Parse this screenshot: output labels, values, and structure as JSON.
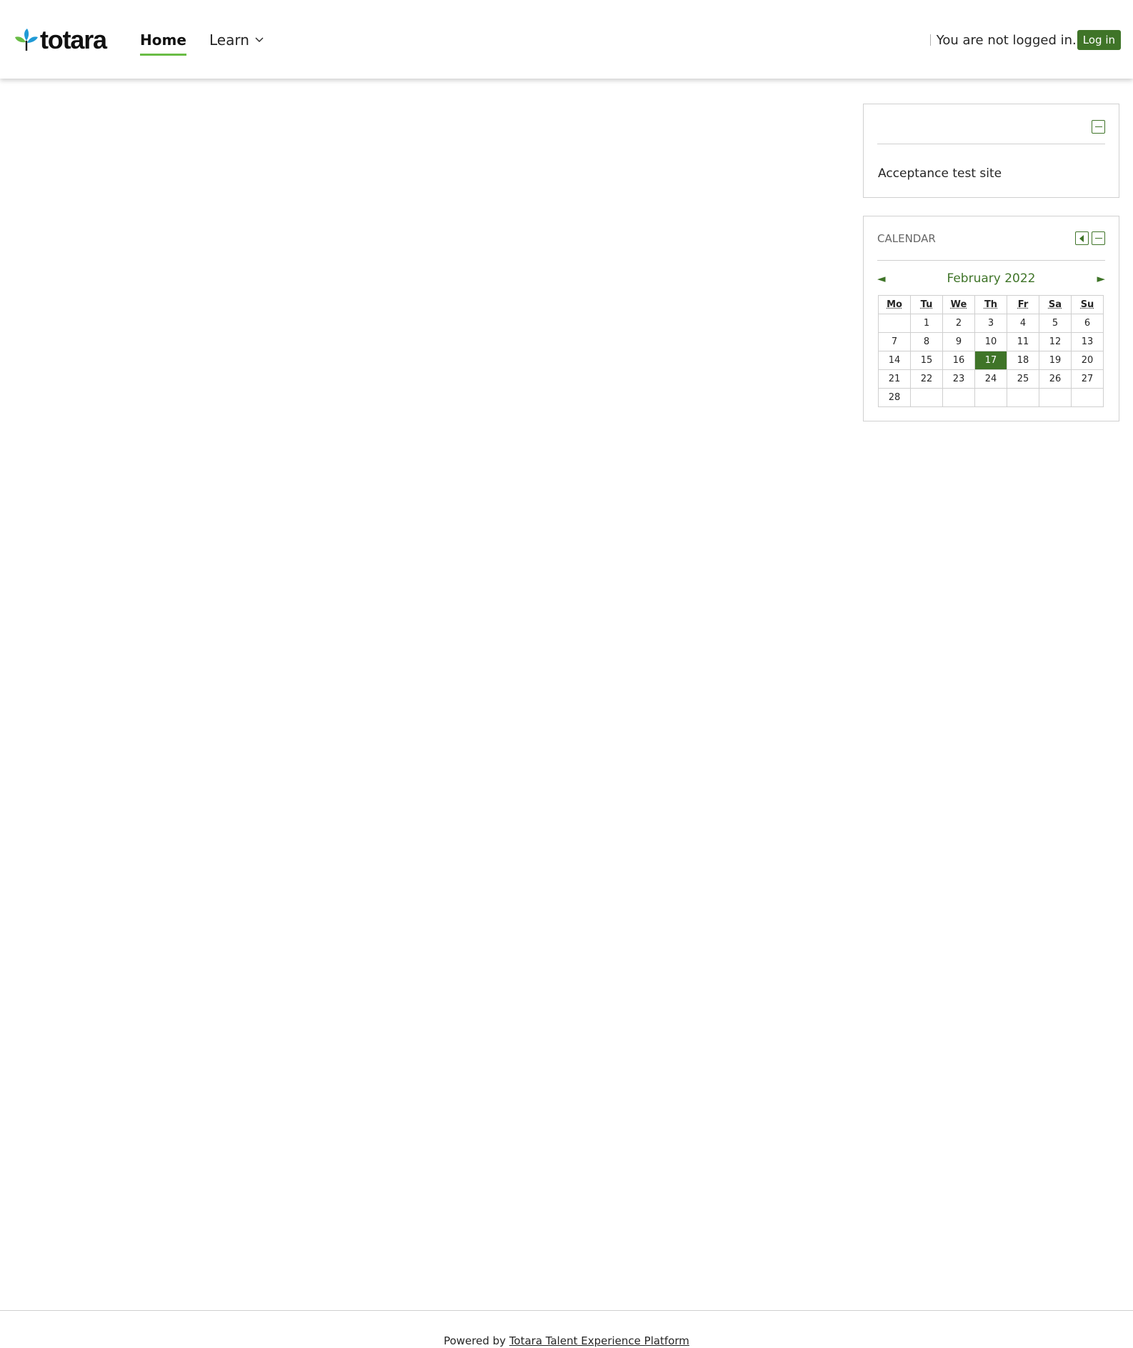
{
  "header": {
    "logo_text": "totara",
    "nav": {
      "home_label": "Home",
      "learn_label": "Learn"
    },
    "login_status": "You are not logged in.",
    "login_button": "Log in"
  },
  "site_block": {
    "text": "Acceptance test site"
  },
  "calendar_block": {
    "title": "CALENDAR",
    "month_label": "February 2022",
    "prev_arrow": "◄",
    "next_arrow": "►",
    "weekdays": [
      "Mo",
      "Tu",
      "We",
      "Th",
      "Fr",
      "Sa",
      "Su"
    ],
    "weeks": [
      [
        "",
        "1",
        "2",
        "3",
        "4",
        "5",
        "6"
      ],
      [
        "7",
        "8",
        "9",
        "10",
        "11",
        "12",
        "13"
      ],
      [
        "14",
        "15",
        "16",
        "17",
        "18",
        "19",
        "20"
      ],
      [
        "21",
        "22",
        "23",
        "24",
        "25",
        "26",
        "27"
      ],
      [
        "28",
        "",
        "",
        "",
        "",
        "",
        ""
      ]
    ],
    "today": "17"
  },
  "footer": {
    "prefix": "Powered by ",
    "link_text": "Totara Talent Experience Platform"
  },
  "colors": {
    "accent": "#3f7428",
    "nav_underline": "#69bc45",
    "logo_leaf_green": "#69bc45",
    "logo_leaf_blue": "#1f9ad6"
  },
  "icons": {
    "logo": "totara-leaf-icon",
    "learn_dropdown": "chevron-down-icon",
    "block_collapse": "minus-box-icon",
    "block_dock": "dock-left-icon"
  }
}
